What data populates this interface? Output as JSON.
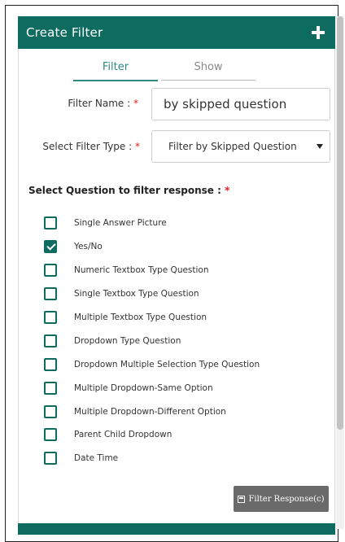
{
  "panel": {
    "title": "Create Filter",
    "add_icon": "plus-icon",
    "header_color": "#0e6b5f"
  },
  "tabs": [
    {
      "label": "Filter",
      "active": true
    },
    {
      "label": "Show",
      "active": false
    }
  ],
  "form": {
    "filter_name": {
      "label": "Filter Name :",
      "required": "*",
      "value": "by skipped question"
    },
    "filter_type": {
      "label": "Select Filter Type :",
      "required": "*",
      "selected": "Filter by Skipped Question"
    }
  },
  "questions_section": {
    "label": "Select Question to filter response :",
    "required": "*",
    "items": [
      {
        "label": "Single Answer Picture",
        "checked": false
      },
      {
        "label": "Yes/No",
        "checked": true
      },
      {
        "label": "Numeric Textbox Type Question",
        "checked": false
      },
      {
        "label": "Single Textbox Type Question",
        "checked": false
      },
      {
        "label": "Multiple Textbox Type Question",
        "checked": false
      },
      {
        "label": "Dropdown Type Question",
        "checked": false
      },
      {
        "label": "Dropdown Multiple Selection Type Question",
        "checked": false
      },
      {
        "label": "Multiple Dropdown-Same Option",
        "checked": false
      },
      {
        "label": "Multiple Dropdown-Different Option",
        "checked": false
      },
      {
        "label": "Parent Child Dropdown",
        "checked": false
      },
      {
        "label": "Date Time",
        "checked": false
      }
    ]
  },
  "filter_button": {
    "label": "Filter Response(c)",
    "icon": "save-icon"
  },
  "colors": {
    "accent": "#0e6b5f",
    "tab_active": "#2d8a80",
    "required": "#e02020",
    "button": "#6a6a6a"
  }
}
